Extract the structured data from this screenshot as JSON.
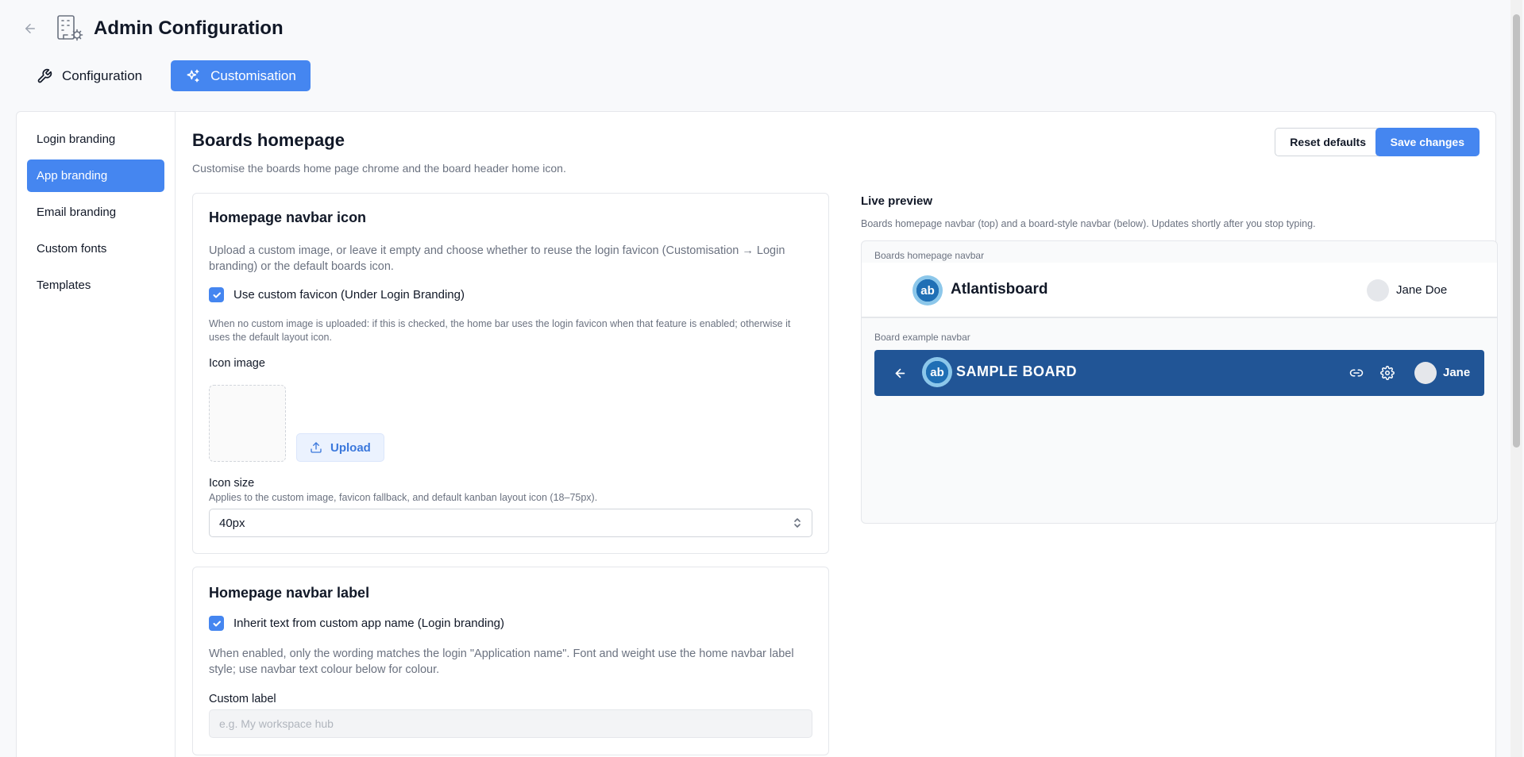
{
  "header": {
    "title": "Admin Configuration",
    "back_icon": "arrow-left-icon",
    "app_icon": "building-gear-icon"
  },
  "tabs": [
    {
      "label": "Configuration",
      "icon": "wrench-icon",
      "active": false
    },
    {
      "label": "Customisation",
      "icon": "sparkles-icon",
      "active": true
    }
  ],
  "sidebar": {
    "items": [
      {
        "label": "Login branding",
        "active": false
      },
      {
        "label": "App branding",
        "active": true
      },
      {
        "label": "Email branding",
        "active": false
      },
      {
        "label": "Custom fonts",
        "active": false
      },
      {
        "label": "Templates",
        "active": false
      }
    ]
  },
  "section": {
    "title": "Boards homepage",
    "subtitle": "Customise the boards home page chrome and the board header home icon.",
    "reset_label": "Reset defaults",
    "save_label": "Save changes"
  },
  "navbar_icon_card": {
    "title": "Homepage navbar icon",
    "description": "Upload a custom image, or leave it empty and choose whether to reuse the login favicon (Customisation → Login branding) or the default boards icon.",
    "checkbox_label": "Use custom favicon (Under Login Branding)",
    "checkbox_checked": true,
    "hint": "When no custom image is uploaded: if this is checked, the home bar uses the login favicon when that feature is enabled; otherwise it uses the default layout icon.",
    "icon_image_label": "Icon image",
    "upload_label": "Upload",
    "icon_size_label": "Icon size",
    "icon_size_hint": "Applies to the custom image, favicon fallback, and default kanban layout icon (18–75px).",
    "icon_size_value": "40px"
  },
  "navbar_label_card": {
    "title": "Homepage navbar label",
    "checkbox_label": "Inherit text from custom app name (Login branding)",
    "checkbox_checked": true,
    "description": "When enabled, only the wording matches the login \"Application name\". Font and weight use the home navbar label style; use navbar text colour below for colour.",
    "custom_label": "Custom label",
    "custom_label_placeholder": "e.g. My workspace hub"
  },
  "preview": {
    "title": "Live preview",
    "subtitle": "Boards homepage navbar (top) and a board-style navbar (below). Updates shortly after you stop typing.",
    "home_navbar_label": "Boards homepage navbar",
    "logo_text": "ab",
    "brand_name": "Atlantisboard",
    "home_user": "Jane Doe",
    "board_navbar_label": "Board example navbar",
    "board_title": "SAMPLE BOARD",
    "board_user": "Jane"
  },
  "colors": {
    "accent": "#4586f0",
    "board_navbar_bg": "#215596",
    "muted_text": "#6b7280"
  }
}
